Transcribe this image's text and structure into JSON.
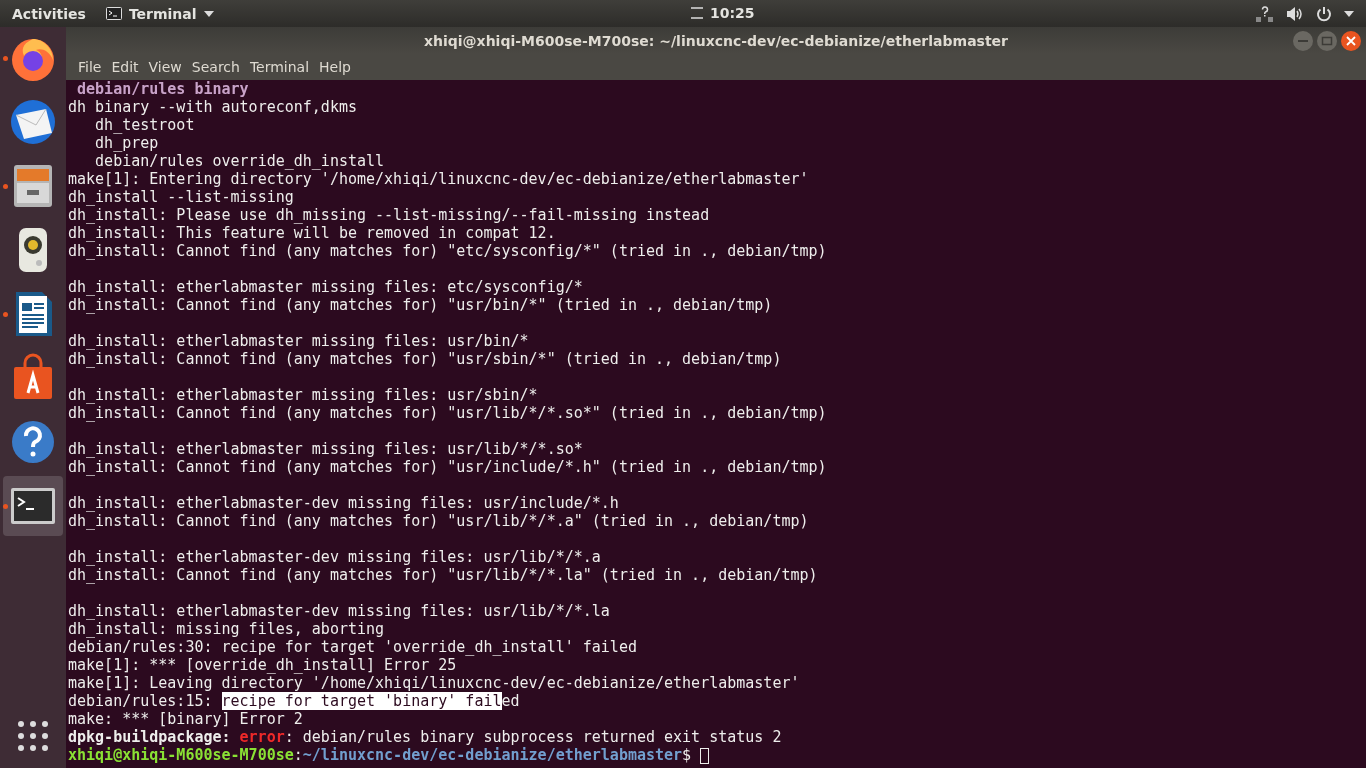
{
  "top_bar": {
    "activities": "Activities",
    "app_menu": "Terminal",
    "clock": "10:25"
  },
  "dock": {
    "items": [
      {
        "kind": "browser",
        "running": true,
        "selected": false
      },
      {
        "kind": "mail",
        "running": false,
        "selected": false
      },
      {
        "kind": "files",
        "running": true,
        "selected": false
      },
      {
        "kind": "music",
        "running": false,
        "selected": false
      },
      {
        "kind": "writer",
        "running": true,
        "selected": false
      },
      {
        "kind": "store",
        "running": false,
        "selected": false
      },
      {
        "kind": "help",
        "running": false,
        "selected": false
      },
      {
        "kind": "terminal",
        "running": true,
        "selected": true
      }
    ]
  },
  "window": {
    "title": "xhiqi@xhiqi-M600se-M700se: ~/linuxcnc-dev/ec-debianize/etherlabmaster"
  },
  "menu": [
    "File",
    "Edit",
    "View",
    "Search",
    "Terminal",
    "Help"
  ],
  "terminal": {
    "lines": [
      {
        "kind": "text",
        "segments": [
          {
            "text": " debian/rules binary",
            "kind": "dim"
          }
        ]
      },
      {
        "kind": "text",
        "segments": [
          {
            "text": "dh binary --with autoreconf,dkms",
            "kind": "plain"
          }
        ]
      },
      {
        "kind": "text",
        "segments": [
          {
            "text": "   dh_testroot",
            "kind": "plain"
          }
        ]
      },
      {
        "kind": "text",
        "segments": [
          {
            "text": "   dh_prep",
            "kind": "plain"
          }
        ]
      },
      {
        "kind": "text",
        "segments": [
          {
            "text": "   debian/rules override_dh_install",
            "kind": "plain"
          }
        ]
      },
      {
        "kind": "text",
        "segments": [
          {
            "text": "make[1]: Entering directory '/home/xhiqi/linuxcnc-dev/ec-debianize/etherlabmaster'",
            "kind": "plain"
          }
        ]
      },
      {
        "kind": "text",
        "segments": [
          {
            "text": "dh_install --list-missing",
            "kind": "plain"
          }
        ]
      },
      {
        "kind": "text",
        "segments": [
          {
            "text": "dh_install: Please use dh_missing --list-missing/--fail-missing instead",
            "kind": "plain"
          }
        ]
      },
      {
        "kind": "text",
        "segments": [
          {
            "text": "dh_install: This feature will be removed in compat 12.",
            "kind": "plain"
          }
        ]
      },
      {
        "kind": "text",
        "segments": [
          {
            "text": "dh_install: Cannot find (any matches for) \"etc/sysconfig/*\" (tried in ., debian/tmp)",
            "kind": "plain"
          }
        ]
      },
      {
        "kind": "blank"
      },
      {
        "kind": "text",
        "segments": [
          {
            "text": "dh_install: etherlabmaster missing files: etc/sysconfig/*",
            "kind": "plain"
          }
        ]
      },
      {
        "kind": "text",
        "segments": [
          {
            "text": "dh_install: Cannot find (any matches for) \"usr/bin/*\" (tried in ., debian/tmp)",
            "kind": "plain"
          }
        ]
      },
      {
        "kind": "blank"
      },
      {
        "kind": "text",
        "segments": [
          {
            "text": "dh_install: etherlabmaster missing files: usr/bin/*",
            "kind": "plain"
          }
        ]
      },
      {
        "kind": "text",
        "segments": [
          {
            "text": "dh_install: Cannot find (any matches for) \"usr/sbin/*\" (tried in ., debian/tmp)",
            "kind": "plain"
          }
        ]
      },
      {
        "kind": "blank"
      },
      {
        "kind": "text",
        "segments": [
          {
            "text": "dh_install: etherlabmaster missing files: usr/sbin/*",
            "kind": "plain"
          }
        ]
      },
      {
        "kind": "text",
        "segments": [
          {
            "text": "dh_install: Cannot find (any matches for) \"usr/lib/*/*.so*\" (tried in ., debian/tmp)",
            "kind": "plain"
          }
        ]
      },
      {
        "kind": "blank"
      },
      {
        "kind": "text",
        "segments": [
          {
            "text": "dh_install: etherlabmaster missing files: usr/lib/*/*.so*",
            "kind": "plain"
          }
        ]
      },
      {
        "kind": "text",
        "segments": [
          {
            "text": "dh_install: Cannot find (any matches for) \"usr/include/*.h\" (tried in ., debian/tmp)",
            "kind": "plain"
          }
        ]
      },
      {
        "kind": "blank"
      },
      {
        "kind": "text",
        "segments": [
          {
            "text": "dh_install: etherlabmaster-dev missing files: usr/include/*.h",
            "kind": "plain"
          }
        ]
      },
      {
        "kind": "text",
        "segments": [
          {
            "text": "dh_install: Cannot find (any matches for) \"usr/lib/*/*.a\" (tried in ., debian/tmp)",
            "kind": "plain"
          }
        ]
      },
      {
        "kind": "blank"
      },
      {
        "kind": "text",
        "segments": [
          {
            "text": "dh_install: etherlabmaster-dev missing files: usr/lib/*/*.a",
            "kind": "plain"
          }
        ]
      },
      {
        "kind": "text",
        "segments": [
          {
            "text": "dh_install: Cannot find (any matches for) \"usr/lib/*/*.la\" (tried in ., debian/tmp)",
            "kind": "plain"
          }
        ]
      },
      {
        "kind": "blank"
      },
      {
        "kind": "text",
        "segments": [
          {
            "text": "dh_install: etherlabmaster-dev missing files: usr/lib/*/*.la",
            "kind": "plain"
          }
        ]
      },
      {
        "kind": "text",
        "segments": [
          {
            "text": "dh_install: missing files, aborting",
            "kind": "plain"
          }
        ]
      },
      {
        "kind": "text",
        "segments": [
          {
            "text": "debian/rules:30: recipe for target 'override_dh_install' failed",
            "kind": "plain"
          }
        ]
      },
      {
        "kind": "text",
        "segments": [
          {
            "text": "make[1]: *** [override_dh_install] Error 25",
            "kind": "plain"
          }
        ]
      },
      {
        "kind": "text",
        "segments": [
          {
            "text": "make[1]: Leaving directory '/home/xhiqi/linuxcnc-dev/ec-debianize/etherlabmaster'",
            "kind": "plain"
          }
        ]
      },
      {
        "kind": "text",
        "segments": [
          {
            "text": "debian/rules:15: ",
            "kind": "plain"
          },
          {
            "text": "recipe for target 'binary' fail",
            "kind": "selected"
          },
          {
            "text": "ed",
            "kind": "plain"
          }
        ]
      },
      {
        "kind": "text",
        "segments": [
          {
            "text": "make: *** [binary] Error 2",
            "kind": "plain"
          }
        ]
      },
      {
        "kind": "text",
        "segments": [
          {
            "text": "dpkg-buildpackage:",
            "kind": "bold"
          },
          {
            "text": "error",
            "kind": "error"
          },
          {
            "text": ": debian/rules binary subprocess returned exit status 2",
            "kind": "plain"
          }
        ]
      },
      {
        "kind": "text",
        "segments": [
          {
            "text": "xhiqi@xhiqi-M600se-M700se",
            "kind": "user"
          },
          {
            "text": ":",
            "kind": "plain"
          },
          {
            "text": "~/linuxcnc-dev/ec-debianize/etherlabmaster",
            "kind": "path"
          },
          {
            "text": "$",
            "kind": "plain"
          }
        ],
        "cursor": true
      }
    ]
  }
}
